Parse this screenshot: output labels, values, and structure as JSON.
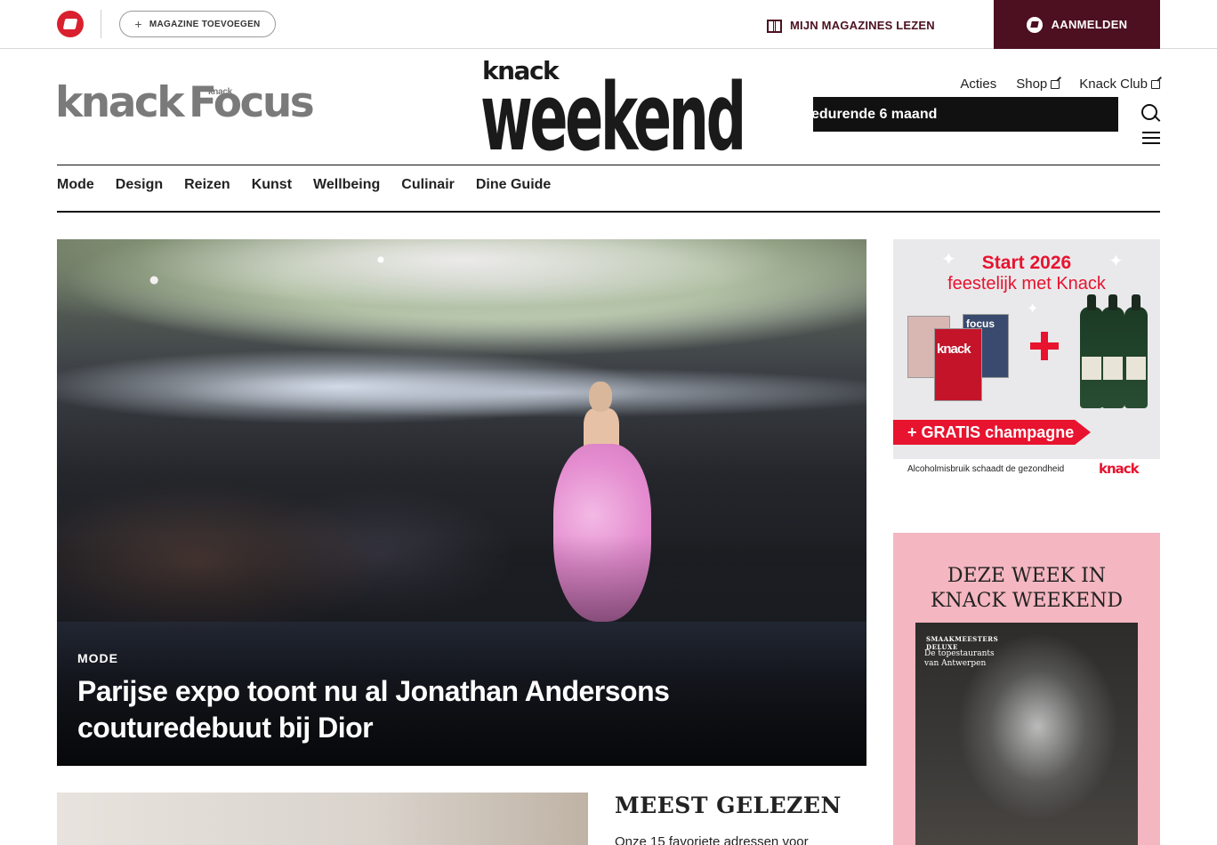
{
  "topbar": {
    "add_magazine": "MAGAZINE TOEVOEGEN",
    "read_magazines": "MIJN MAGAZINES LEZEN",
    "login": "AANMELDEN"
  },
  "header": {
    "brand_knack": "knack",
    "brand_focus": "Focus",
    "brand_focus_small": "knack",
    "logo_top": "knack",
    "logo_bottom": "weekend",
    "links": [
      "Acties",
      "Shop",
      "Knack Club"
    ],
    "ticker": "edurende 6 maand"
  },
  "nav": {
    "items": [
      "Mode",
      "Design",
      "Reizen",
      "Kunst",
      "Wellbeing",
      "Culinair",
      "Dine Guide"
    ]
  },
  "hero": {
    "category": "MODE",
    "title": "Parijse expo toont nu al Jonathan Andersons couturedebuut bij Dior"
  },
  "most_read": {
    "title": "MEEST GELEZEN",
    "first_item": "Onze 15 favoriete adressen voor"
  },
  "ad": {
    "line1": "Start 2026",
    "line2": "feestelijk met Knack",
    "mag_knack": "knack",
    "mag_focus": "focus",
    "ribbon": "+ GRATIS champagne",
    "disclaimer": "Alcoholmisbruik schaadt de gezondheid",
    "brand": "knack"
  },
  "week": {
    "title_line1": "DEZE WEEK IN",
    "title_line2": "KNACK WEEKEND",
    "cover_tag_line1": "SMAAKMEESTERS",
    "cover_tag_line2": "DELUXE",
    "cover_sub_line1": "De topestaurants",
    "cover_sub_line2": "van Antwerpen"
  },
  "colors": {
    "brand_dark": "#4d1020",
    "ad_red": "#e8132f",
    "week_bg": "#f4b6c0"
  }
}
